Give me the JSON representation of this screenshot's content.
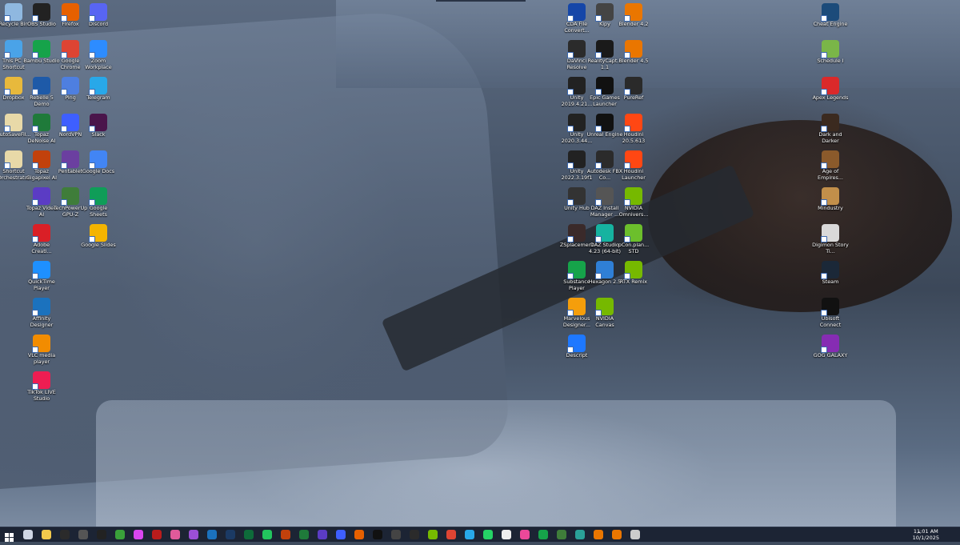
{
  "desktop": {
    "icons": [
      {
        "label": "Recycle Bin",
        "icon": "recycle-bin-icon",
        "color": "#8fb8e0"
      },
      {
        "label": "OBS Studio",
        "icon": "obs-icon",
        "color": "#222222"
      },
      {
        "label": "Firefox",
        "icon": "firefox-icon",
        "color": "#e66000"
      },
      {
        "label": "Discord",
        "icon": "discord-icon",
        "color": "#5865f2"
      },
      {
        "label": "This PC - Shortcut",
        "icon": "this-pc-icon",
        "color": "#4aa3e8"
      },
      {
        "label": "Bambu Studio",
        "icon": "bambu-studio-icon",
        "color": "#16a34a"
      },
      {
        "label": "Google Chrome",
        "icon": "chrome-icon",
        "color": "#dd4433"
      },
      {
        "label": "Zoom Workplace",
        "icon": "zoom-icon",
        "color": "#2d8cff"
      },
      {
        "label": "Dropbox",
        "icon": "folder-icon",
        "color": "#e8b93c"
      },
      {
        "label": "Rebelle 5 Demo",
        "icon": "rebelle-icon",
        "color": "#1e5aa8"
      },
      {
        "label": "Ping",
        "icon": "ping-icon",
        "color": "#4e7fe0"
      },
      {
        "label": "Telegram",
        "icon": "telegram-icon",
        "color": "#28a8e9"
      },
      {
        "label": "AutoSaveFil...",
        "icon": "document-icon",
        "color": "#e8d9a8"
      },
      {
        "label": "Topaz DeNoise AI",
        "icon": "topaz-denoise-icon",
        "color": "#1f7a3a"
      },
      {
        "label": "NordVPN",
        "icon": "nordvpn-icon",
        "color": "#3e5fff"
      },
      {
        "label": "Slack",
        "icon": "slack-icon",
        "color": "#4a154b"
      },
      {
        "label": "Shortcut Orchestrator",
        "icon": "document-icon",
        "color": "#e8d9a8"
      },
      {
        "label": "Topaz Gigapixel AI",
        "icon": "topaz-gigapixel-icon",
        "color": "#c2410c"
      },
      {
        "label": "Pentablet",
        "icon": "pentablet-icon",
        "color": "#6b3fa0"
      },
      {
        "label": "Google Docs",
        "icon": "google-docs-icon",
        "color": "#4285f4"
      },
      {
        "label": "Topaz Video AI",
        "icon": "topaz-video-icon",
        "color": "#5b3cc4"
      },
      {
        "label": "TechPowerUp GPU-Z",
        "icon": "gpuz-icon",
        "color": "#3f7d3a"
      },
      {
        "label": "Google Sheets",
        "icon": "google-sheets-icon",
        "color": "#0f9d58"
      },
      {
        "label": "Adobe Creati...",
        "icon": "adobe-cc-icon",
        "color": "#da1f26"
      },
      {
        "label": "Google Slides",
        "icon": "google-slides-icon",
        "color": "#f4b400"
      },
      {
        "label": "QuickTime Player",
        "icon": "quicktime-icon",
        "color": "#1e90ff"
      },
      {
        "label": "Affinity Designer",
        "icon": "affinity-designer-icon",
        "color": "#1b72be"
      },
      {
        "label": "VLC media player",
        "icon": "vlc-icon",
        "color": "#f28c00"
      },
      {
        "label": "TikTok LIVE Studio",
        "icon": "tiktok-icon",
        "color": "#ee1d52"
      },
      {
        "label": "CDA File Convert...",
        "icon": "cda-converter-icon",
        "color": "#1546a8"
      },
      {
        "label": "Kipy",
        "icon": "kipy-icon",
        "color": "#444444"
      },
      {
        "label": "Blender 4.2",
        "icon": "blender-icon",
        "color": "#ea7600"
      },
      {
        "label": "DaVinci Resolve",
        "icon": "davinci-resolve-icon",
        "color": "#2b2b2b"
      },
      {
        "label": "RealityCapt... 1.1",
        "icon": "realitycapture-icon",
        "color": "#1a1a1a"
      },
      {
        "label": "Blender 4.5",
        "icon": "blender-icon",
        "color": "#ea7600"
      },
      {
        "label": "Unity 2019.4.21...",
        "icon": "unity-icon",
        "color": "#222222"
      },
      {
        "label": "Epic Games Launcher",
        "icon": "epic-games-icon",
        "color": "#111111"
      },
      {
        "label": "PureRef",
        "icon": "pureref-icon",
        "color": "#2a2a2a"
      },
      {
        "label": "Unity 2020.3.44...",
        "icon": "unity-icon",
        "color": "#222222"
      },
      {
        "label": "Unreal Engine",
        "icon": "unreal-engine-icon",
        "color": "#111111"
      },
      {
        "label": "Houdini 20.5.613",
        "icon": "houdini-icon",
        "color": "#ff4713"
      },
      {
        "label": "Unity 2022.3.19f1",
        "icon": "unity-icon",
        "color": "#222222"
      },
      {
        "label": "Autodesk FBX Co...",
        "icon": "autodesk-fbx-icon",
        "color": "#2b2b2b"
      },
      {
        "label": "Houdini Launcher",
        "icon": "houdini-icon",
        "color": "#ff4713"
      },
      {
        "label": "Unity Hub",
        "icon": "unity-hub-icon",
        "color": "#333333"
      },
      {
        "label": "DAZ Install Manager ...",
        "icon": "daz-install-icon",
        "color": "#555555"
      },
      {
        "label": "NVIDIA Omnivers...",
        "icon": "nvidia-omniverse-icon",
        "color": "#76b900"
      },
      {
        "label": "ZSplacement",
        "icon": "zsplacement-icon",
        "color": "#3a2a2a"
      },
      {
        "label": "DAZ Studio 4.23 (64-bit)",
        "icon": "daz-studio-icon",
        "color": "#16b3a0"
      },
      {
        "label": "pCon.plan... STD",
        "icon": "pcon-planner-icon",
        "color": "#6cbf2c"
      },
      {
        "label": "Substance Player",
        "icon": "substance-player-icon",
        "color": "#16a34a"
      },
      {
        "label": "Hexagon 2.5",
        "icon": "hexagon-icon",
        "color": "#2f7fd6"
      },
      {
        "label": "RTX Remix",
        "icon": "rtx-remix-icon",
        "color": "#76b900"
      },
      {
        "label": "Marvelous Designer...",
        "icon": "marvelous-designer-icon",
        "color": "#f59e0b"
      },
      {
        "label": "NVIDIA Canvas",
        "icon": "nvidia-canvas-icon",
        "color": "#76b900"
      },
      {
        "label": "Descript",
        "icon": "descript-icon",
        "color": "#1e78ff"
      },
      {
        "label": "Cheat Engine",
        "icon": "cheat-engine-icon",
        "color": "#1c4b7a"
      },
      {
        "label": "Schedule I",
        "icon": "schedule-i-icon",
        "color": "#7ab648"
      },
      {
        "label": "Apex Legends",
        "icon": "apex-legends-icon",
        "color": "#da292a"
      },
      {
        "label": "Dark and Darker",
        "icon": "dark-and-darker-icon",
        "color": "#3b2a1f"
      },
      {
        "label": "Age of Empires...",
        "icon": "age-of-empires-icon",
        "color": "#8b5a2b"
      },
      {
        "label": "Mindustry",
        "icon": "mindustry-icon",
        "color": "#c28f4a"
      },
      {
        "label": "Digimon Story Ti...",
        "icon": "digimon-icon",
        "color": "#d9d9d9"
      },
      {
        "label": "Steam",
        "icon": "steam-icon",
        "color": "#1b2838"
      },
      {
        "label": "Ubisoft Connect",
        "icon": "ubisoft-connect-icon",
        "color": "#111111"
      },
      {
        "label": "GOG GALAXY",
        "icon": "gog-galaxy-icon",
        "color": "#862cb3"
      }
    ]
  },
  "taskbar": {
    "items": [
      {
        "icon": "start-icon",
        "color": "#ffffff"
      },
      {
        "icon": "task-view-icon",
        "color": "#cfd6e4"
      },
      {
        "icon": "file-explorer-icon",
        "color": "#f2c94c"
      },
      {
        "icon": "obs-icon",
        "color": "#2b2b2b"
      },
      {
        "icon": "kipy-icon",
        "color": "#555555"
      },
      {
        "icon": "cat-app-icon",
        "color": "#222222"
      },
      {
        "icon": "xbox-icon",
        "color": "#3aa13a"
      },
      {
        "icon": "colorful-app-icon",
        "color": "#d946ef"
      },
      {
        "icon": "record-icon",
        "color": "#b91c1c"
      },
      {
        "icon": "krita-icon",
        "color": "#e05a9a"
      },
      {
        "icon": "affinity-photo-icon",
        "color": "#9b4fd6"
      },
      {
        "icon": "affinity-designer-icon",
        "color": "#1b72be"
      },
      {
        "icon": "photoshop-icon",
        "color": "#1b3a64"
      },
      {
        "icon": "substance-icon",
        "color": "#0e6b3a"
      },
      {
        "icon": "play-icon",
        "color": "#22c55e"
      },
      {
        "icon": "topaz-gigapixel-icon",
        "color": "#c2410c"
      },
      {
        "icon": "topaz-denoise-icon",
        "color": "#1f7a3a"
      },
      {
        "icon": "topaz-video-icon",
        "color": "#5b3cc4"
      },
      {
        "icon": "nordvpn-icon",
        "color": "#3e5fff"
      },
      {
        "icon": "firefox-icon",
        "color": "#e66000"
      },
      {
        "icon": "epic-games-icon",
        "color": "#111111"
      },
      {
        "icon": "unity-icon",
        "color": "#444444"
      },
      {
        "icon": "terminal-icon",
        "color": "#2b2b2b"
      },
      {
        "icon": "nvidia-icon",
        "color": "#76b900"
      },
      {
        "icon": "chrome-icon",
        "color": "#dd4433"
      },
      {
        "icon": "telegram-icon",
        "color": "#28a8e9"
      },
      {
        "icon": "whatsapp-icon",
        "color": "#25d366"
      },
      {
        "icon": "unreal-engine-icon",
        "color": "#eeeeee"
      },
      {
        "icon": "pink-app-icon",
        "color": "#ec4899"
      },
      {
        "icon": "bambu-studio-icon",
        "color": "#16a34a"
      },
      {
        "icon": "gpuz-icon",
        "color": "#3f7d3a"
      },
      {
        "icon": "image-app-icon",
        "color": "#2aa198"
      },
      {
        "icon": "blender-icon",
        "color": "#ea7600"
      },
      {
        "icon": "blender-icon",
        "color": "#ea7600"
      },
      {
        "icon": "pureref-icon",
        "color": "#cccccc"
      }
    ]
  },
  "tray": {
    "chevron": "^",
    "time": "11:01 AM",
    "date": "10/1/2025"
  }
}
